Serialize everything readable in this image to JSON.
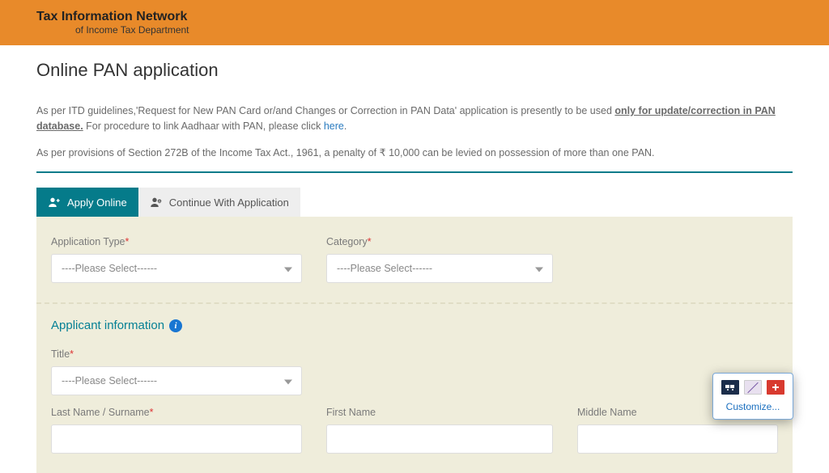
{
  "header": {
    "title": "Tax Information Network",
    "subtitle": "of Income Tax Department"
  },
  "page": {
    "title": "Online PAN application"
  },
  "notes": {
    "line1_prefix": "As per ITD guidelines,'Request for New PAN Card or/and Changes or Correction in PAN Data' application is presently to be used ",
    "line1_underline": "only for update/correction in PAN database.",
    "line1_suffix": " For procedure to link Aadhaar with PAN, please click ",
    "line1_link": "here",
    "line1_end": ".",
    "line2_prefix": "As per provisions of Section 272B of the Income Tax Act., 1961, a penalty of ",
    "line2_amount": "₹ 10,000",
    "line2_suffix": " can be levied on possession of more than one PAN."
  },
  "tabs": {
    "apply": "Apply Online",
    "continue": "Continue With Application"
  },
  "form": {
    "app_type_label": "Application Type",
    "category_label": "Category",
    "placeholder": "----Please Select------",
    "section_title": "Applicant information",
    "title_label": "Title",
    "last_name_label": "Last Name / Surname",
    "first_name_label": "First Name",
    "middle_name_label": "Middle Name"
  },
  "popup": {
    "customize": "Customize..."
  }
}
